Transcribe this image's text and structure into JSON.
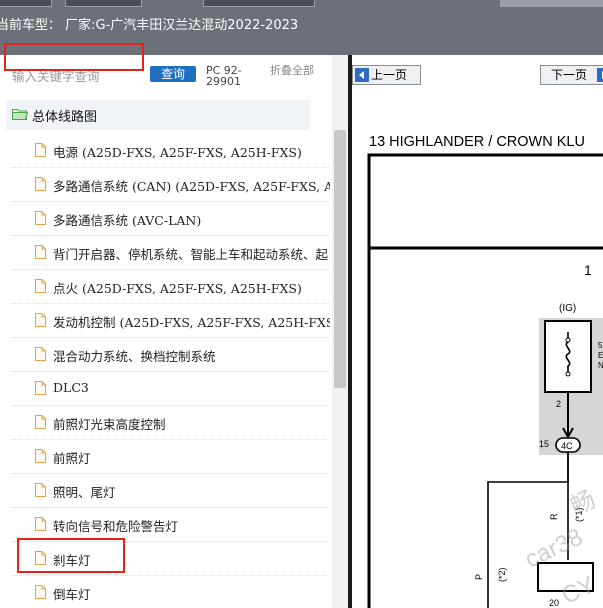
{
  "header": {
    "title": "当前车型： 厂家:G-广汽丰田汉兰达混动2022-2023"
  },
  "search": {
    "placeholder": "输入关键字查询",
    "query_label": "查询",
    "pc_code": "PC 92-29901",
    "collapse_label": "折叠全部"
  },
  "tree": {
    "root": {
      "label": "总体线路图"
    },
    "items": [
      {
        "label": "电源 (A25D-FXS, A25F-FXS, A25H-FXS)"
      },
      {
        "label": "多路通信系统 (CAN) (A25D-FXS, A25F-FXS, A25H"
      },
      {
        "label": "多路通信系统 (AVC-LAN)"
      },
      {
        "label": "背门开启器、停机系统、智能上车和起动系统、起"
      },
      {
        "label": "点火 (A25D-FXS, A25F-FXS, A25H-FXS)"
      },
      {
        "label": "发动机控制 (A25D-FXS, A25F-FXS, A25H-FXS)"
      },
      {
        "label": "混合动力系统、换档控制系统"
      },
      {
        "label": "DLC3"
      },
      {
        "label": "前照灯光束高度控制"
      },
      {
        "label": "前照灯"
      },
      {
        "label": "照明、尾灯"
      },
      {
        "label": "转向信号和危险警告灯"
      },
      {
        "label": "刹车灯"
      },
      {
        "label": "倒车灯"
      }
    ]
  },
  "viewer": {
    "prev_label": "上一页",
    "next_label": "下一页",
    "doc_title": "13  HIGHLANDER / CROWN KLU",
    "diagram": {
      "page_num": "1",
      "ig_label": "(IG)",
      "fuse_pin_top": "2",
      "side_pin": "5",
      "side_letter_e": "E",
      "side_letter_n": "N",
      "pin_15": "15",
      "connector": "4C",
      "wire_r": "R",
      "note_1": "(*1)",
      "wire_p": "P",
      "note_2": "(*2)",
      "pin_20": "20"
    },
    "watermarks": [
      "畅",
      "car38",
      "CY"
    ]
  }
}
